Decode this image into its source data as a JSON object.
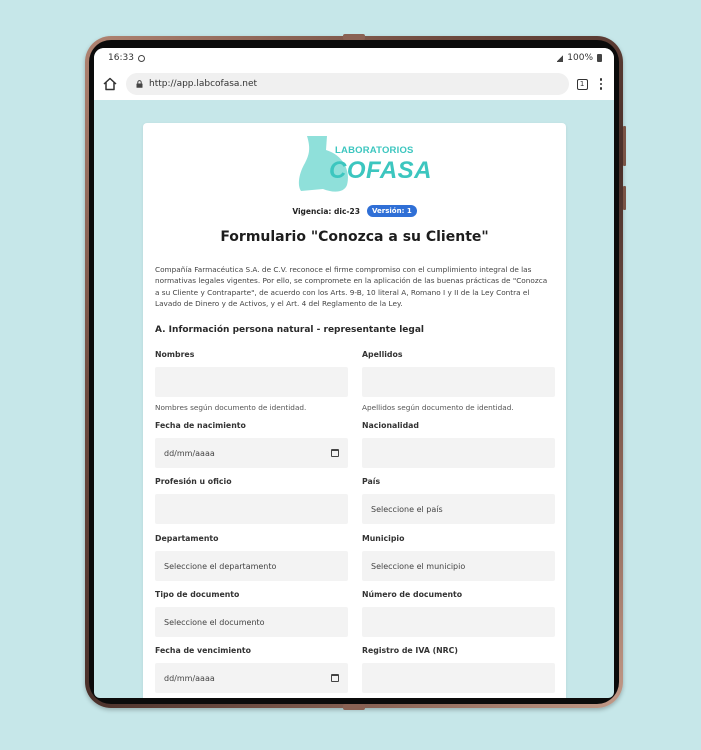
{
  "status": {
    "time": "16:33",
    "battery": "100%"
  },
  "browser": {
    "url": "http://app.labcofasa.net",
    "tab_count": "1"
  },
  "logo": {
    "top_text": "LABORATORIOS",
    "main_text": "COFASA"
  },
  "meta": {
    "vigencia": "Vigencia: dic-23",
    "version": "Versión: 1"
  },
  "form": {
    "title": "Formulario \"Conozca a su Cliente\"",
    "intro": "Compañía Farmacéutica S.A. de C.V. reconoce el firme compromiso con el cumplimiento integral de las normativas legales vigentes. Por ello, se compromete en la aplicación de las buenas prácticas de \"Conozca a su Cliente y Contraparte\", de acuerdo con los Arts. 9-B, 10 literal A, Romano I y II de la Ley Contra el Lavado de Dinero y de Activos, y el Art. 4 del Reglamento de la Ley.",
    "section": "A. Información persona natural - representante legal",
    "fields": {
      "nombres": {
        "label": "Nombres",
        "value": "",
        "help": "Nombres según documento de identidad."
      },
      "apellidos": {
        "label": "Apellidos",
        "value": "",
        "help": "Apellidos según documento de identidad."
      },
      "fecha_nacimiento": {
        "label": "Fecha de nacimiento",
        "value": "dd/mm/aaaa"
      },
      "nacionalidad": {
        "label": "Nacionalidad",
        "value": ""
      },
      "profesion": {
        "label": "Profesión u oficio",
        "value": ""
      },
      "pais": {
        "label": "País",
        "value": "Seleccione el país"
      },
      "departamento": {
        "label": "Departamento",
        "value": "Seleccione el departamento"
      },
      "municipio": {
        "label": "Municipio",
        "value": "Seleccione el municipio"
      },
      "tipo_documento": {
        "label": "Tipo de documento",
        "value": "Seleccione el documento"
      },
      "numero_documento": {
        "label": "Número de documento",
        "value": ""
      },
      "fecha_vencimiento": {
        "label": "Fecha de vencimiento",
        "value": "dd/mm/aaaa"
      },
      "registro_iva": {
        "label": "Registro de IVA (NRC)",
        "value": ""
      }
    }
  },
  "colors": {
    "background": "#c6e7e9",
    "brand": "#3cc6bf",
    "badge": "#2f6fd6"
  }
}
